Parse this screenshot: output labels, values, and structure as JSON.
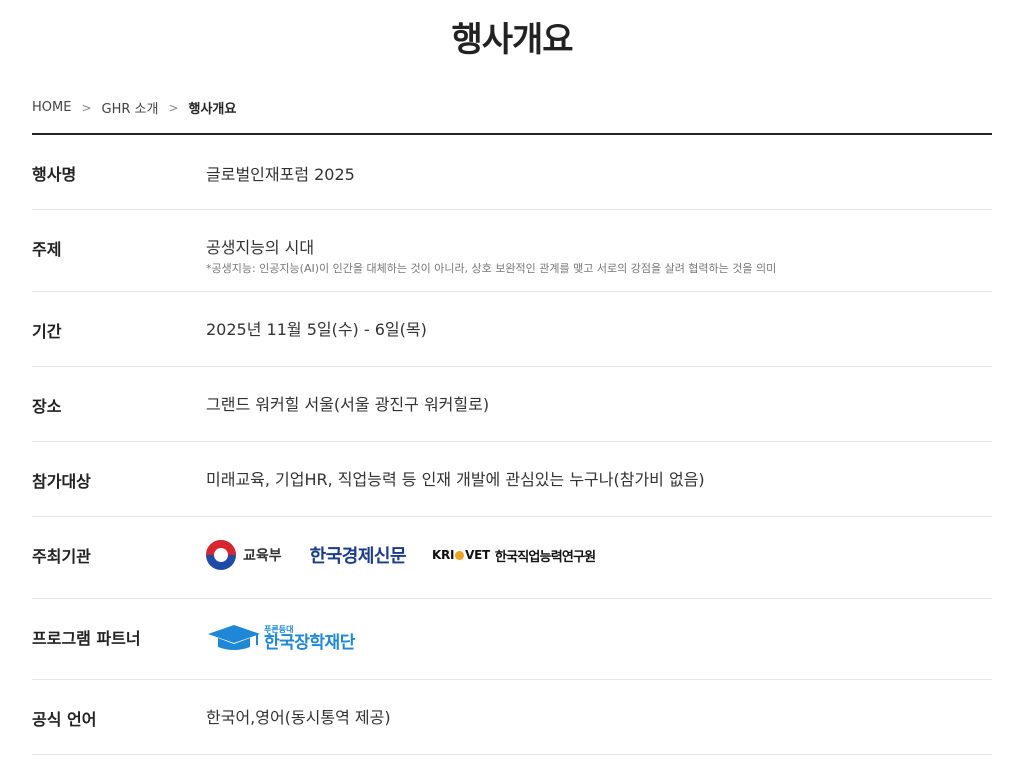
{
  "page": {
    "title": "행사개요"
  },
  "breadcrumb": {
    "home": "HOME",
    "section": "GHR 소개",
    "current": "행사개요",
    "separator": ">"
  },
  "rows": [
    {
      "label": "행사명",
      "value": "글로벌인재포럼 2025"
    },
    {
      "label": "주제",
      "value": "공생지능의 시대",
      "note": "*공생지능: 인공지능(AI)이 인간을 대체하는 것이 아니라, 상호 보완적인 관계를 맺고 서로의 강점을 살려 협력하는 것을 의미"
    },
    {
      "label": "기간",
      "value": "2025년 11월 5일(수) - 6일(목)"
    },
    {
      "label": "장소",
      "value": "그랜드 워커힐 서울(서울 광진구 워커힐로)"
    },
    {
      "label": "참가대상",
      "value": "미래교육, 기업HR, 직업능력 등 인재 개발에 관심있는 누구나(참가비 없음)"
    },
    {
      "label": "주최기관"
    },
    {
      "label": "프로그램 파트너"
    },
    {
      "label": "공식 언어",
      "value": "한국어,영어(동시통역 제공)"
    }
  ],
  "hosts": {
    "moe": "교육부",
    "hankyung": "한국경제신문",
    "krivet_en_1": "KRI",
    "krivet_en_2": "VET",
    "krivet_kr": "한국직업능력연구원"
  },
  "partner": {
    "small": "푸른등대",
    "name": "한국장학재단"
  },
  "colors": {
    "hankyung": "#1a3b8a",
    "kosaf": "#1e88d6",
    "krivet_dot": "#f2a01f",
    "moe_red": "#d8262e",
    "moe_blue": "#1f4aa8"
  }
}
